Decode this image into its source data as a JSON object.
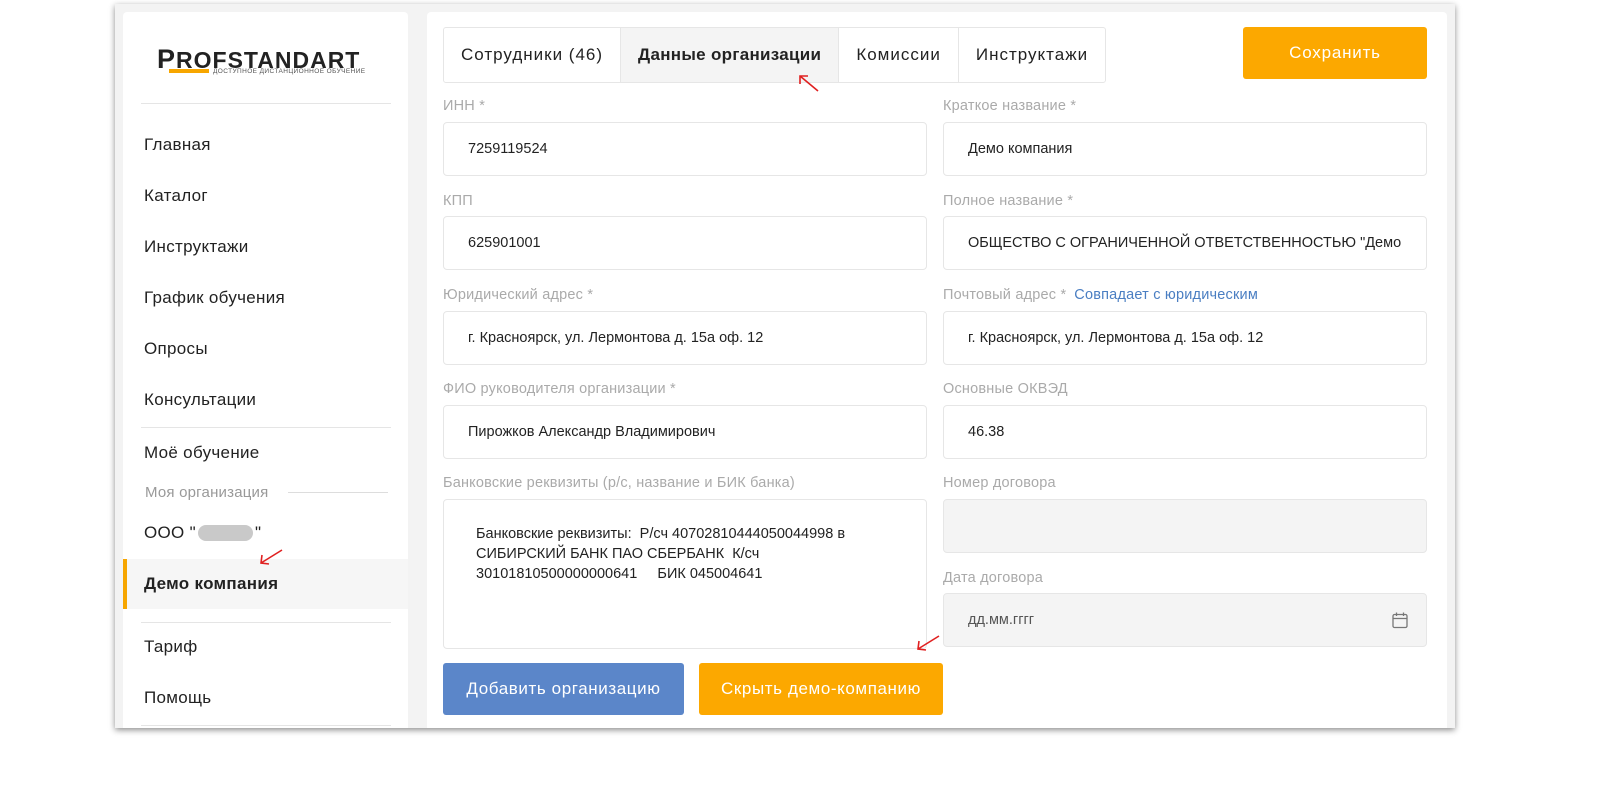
{
  "logo": {
    "text": "PROFSTANDART",
    "tagline": "ДОСТУПНОЕ ДИСТАНЦИОННОЕ ОБУЧЕНИЕ"
  },
  "sidebar": {
    "items": [
      {
        "label": "Главная"
      },
      {
        "label": "Каталог"
      },
      {
        "label": "Инструктажи"
      },
      {
        "label": "График обучения"
      },
      {
        "label": "Опросы"
      },
      {
        "label": "Консультации"
      },
      {
        "label": "Моё обучение"
      }
    ],
    "section_label": "Моя организация",
    "org_prefix": "ООО \"",
    "org_suffix": "\"",
    "active_org": "Демо компания",
    "bottom_items": [
      {
        "label": "Тариф"
      },
      {
        "label": "Помощь"
      }
    ]
  },
  "tabs": [
    {
      "label": "Сотрудники (46)"
    },
    {
      "label": "Данные организации",
      "active": true
    },
    {
      "label": "Комиссии"
    },
    {
      "label": "Инструктажи"
    }
  ],
  "save_label": "Сохранить",
  "form": {
    "inn": {
      "label": "ИНН *",
      "value": "7259119524"
    },
    "short_name": {
      "label": "Краткое название *",
      "value": "Демо компания"
    },
    "kpp": {
      "label": "КПП",
      "value": "625901001"
    },
    "full_name": {
      "label": "Полное название *",
      "value": "ОБЩЕСТВО С ОГРАНИЧЕННОЙ ОТВЕТСТВЕННОСТЬЮ \"Демо"
    },
    "legal_address": {
      "label": "Юридический адрес *",
      "value": "г. Красноярск, ул. Лермонтова д. 15а оф. 12"
    },
    "postal_address": {
      "label": "Почтовый адрес *",
      "link": "Совпадает с юридическим",
      "value": "г. Красноярск, ул. Лермонтова д. 15а оф. 12"
    },
    "director": {
      "label": "ФИО руководителя организации *",
      "value": "Пирожков Александр Владимирович"
    },
    "okved": {
      "label": "Основные ОКВЭД",
      "value": "46.38"
    },
    "bank": {
      "label": "Банковские реквизиты (р/с, название и БИК банка)",
      "value": "Банковские реквизиты:  Р/сч 40702810444050044998 в СИБИРСКИЙ БАНК ПАО СБЕРБАНК  К/сч 30101810500000000641     БИК 045004641"
    },
    "contract_number": {
      "label": "Номер договора",
      "value": ""
    },
    "contract_date": {
      "label": "Дата договора",
      "placeholder": "дд.мм.гггг"
    }
  },
  "buttons": {
    "add_org": "Добавить организацию",
    "hide_demo": "Скрыть демо-компанию"
  },
  "colors": {
    "accent": "#fca800",
    "blue_button": "#5b86c9",
    "link": "#4a7ec2",
    "annotation": "#e02020"
  }
}
